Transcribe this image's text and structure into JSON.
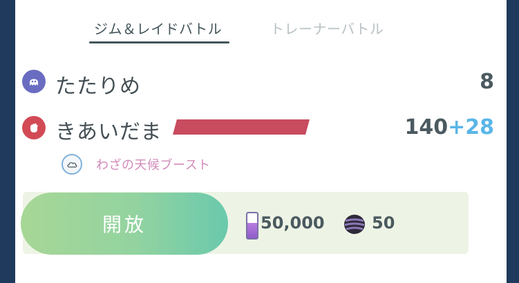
{
  "tabs": [
    {
      "label": "ジム＆レイドバトル",
      "active": true
    },
    {
      "label": "トレーナーバトル",
      "active": false
    }
  ],
  "moves": [
    {
      "name": "たたりめ",
      "type_icon": "ghost-type-icon",
      "power": "8",
      "bonus": ""
    },
    {
      "name": "きあいだま",
      "type_icon": "fighting-type-icon",
      "power": "140",
      "bonus": "+28",
      "energy_bar_color": "#c84b5e"
    }
  ],
  "weather_boost": {
    "icon": "cloud-icon",
    "label": "わざの天候ブースト"
  },
  "unlock": {
    "button_label": "開放",
    "stardust_icon": "stardust-icon",
    "stardust_cost": "50,000",
    "candy_icon": "candy-icon",
    "candy_cost": "50"
  },
  "colors": {
    "ghost": "#6a6cc1",
    "fighting": "#d24a55",
    "bonus": "#5ab6e8",
    "weather_text": "#d28ab9",
    "button_gradient_start": "#a7d796",
    "button_gradient_end": "#6ac9ac"
  }
}
